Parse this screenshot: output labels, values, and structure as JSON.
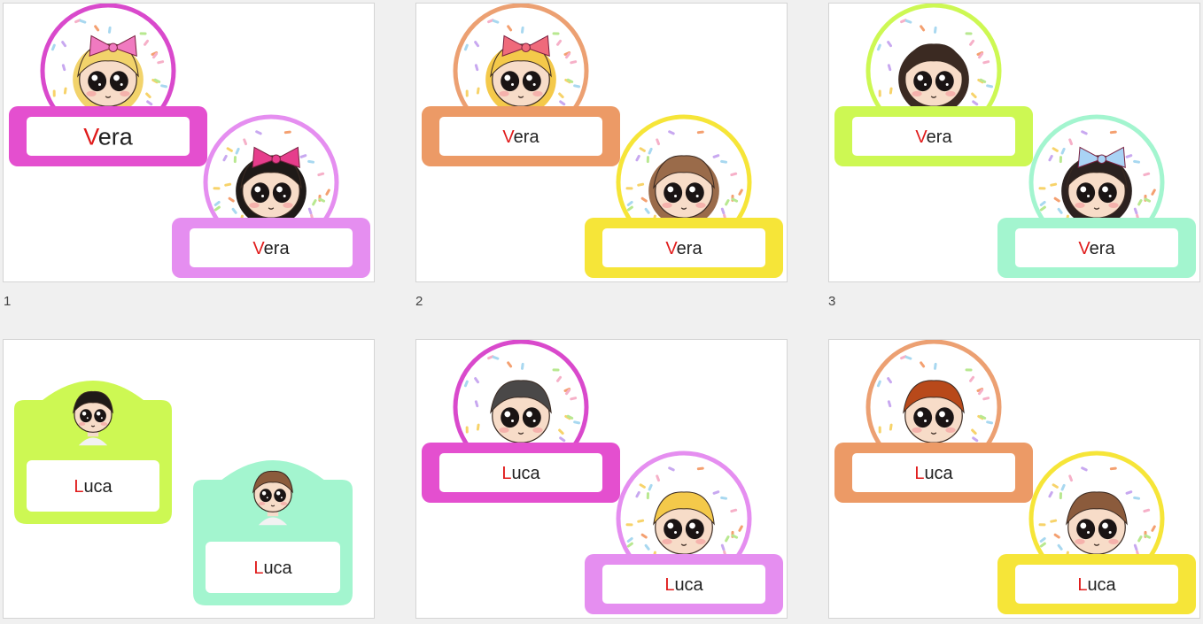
{
  "pages": [
    {
      "number": "1",
      "name_first": "V",
      "name_rest": "era",
      "big_first": true,
      "colors": {
        "frame_a": "#e44fcf",
        "frame_b": "#e58ef0",
        "ring_a": "#d949cc",
        "ring_b": "#e58ef0",
        "hair_a": "#f2d36b",
        "hair_b": "#1f1a18",
        "bow_a": "#f07ac0",
        "bow_b": "#e63d8c"
      }
    },
    {
      "number": "2",
      "name_first": "V",
      "name_rest": "era",
      "big_first": false,
      "colors": {
        "frame_a": "#ec9a66",
        "frame_b": "#f6e538",
        "ring_a": "#eca072",
        "ring_b": "#f6e538",
        "hair_a": "#f4c94a",
        "hair_b": "#9a6b4a",
        "bow_a": "#ef6a7b",
        "bow_b": ""
      }
    },
    {
      "number": "3",
      "name_first": "V",
      "name_rest": "era",
      "big_first": false,
      "colors": {
        "frame_a": "#cdf853",
        "frame_b": "#a3f5cf",
        "ring_a": "#cdf853",
        "ring_b": "#a3f5cf",
        "hair_a": "#3b2a22",
        "hair_b": "#2c2220",
        "bow_a": "",
        "bow_b": "#a9d3f5"
      }
    },
    {
      "number": "",
      "name_first": "L",
      "name_rest": "uca",
      "big_first": false,
      "colors": {
        "frame_a": "#cdf853",
        "frame_b": "#a3f5cf",
        "ring_a": "",
        "ring_b": "",
        "hair_a": "#1f1a18",
        "hair_b": "#8b5b3c",
        "bow_a": "",
        "bow_b": ""
      }
    },
    {
      "number": "",
      "name_first": "L",
      "name_rest": "uca",
      "big_first": false,
      "colors": {
        "frame_a": "#e44fcf",
        "frame_b": "#e58ef0",
        "ring_a": "#d949cc",
        "ring_b": "#e58ef0",
        "hair_a": "#4a4848",
        "hair_b": "#f4c94a",
        "bow_a": "",
        "bow_b": ""
      }
    },
    {
      "number": "",
      "name_first": "L",
      "name_rest": "uca",
      "big_first": false,
      "colors": {
        "frame_a": "#ec9a66",
        "frame_b": "#f6e538",
        "ring_a": "#eca072",
        "ring_b": "#f6e538",
        "hair_a": "#b8491a",
        "hair_b": "#8b5b3c",
        "bow_a": "",
        "bow_b": ""
      }
    }
  ]
}
